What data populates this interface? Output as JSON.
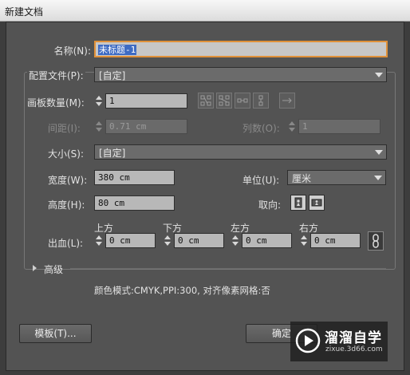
{
  "window": {
    "title": "新建文档"
  },
  "form": {
    "name_label": "名称(N):",
    "name_value": "未标题-1",
    "profile_label": "配置文件(P):",
    "profile_value": "[自定]",
    "artboards_label": "画板数量(M):",
    "artboards_value": "1",
    "spacing_label": "间距(I):",
    "spacing_value": "0.71 cm",
    "columns_label": "列数(O):",
    "columns_value": "1",
    "size_label": "大小(S):",
    "size_value": "[自定]",
    "width_label": "宽度(W):",
    "width_value": "380 cm",
    "units_label": "单位(U):",
    "units_value": "厘米",
    "height_label": "高度(H):",
    "height_value": "80 cm",
    "orientation_label": "取向:",
    "bleed_label": "出血(L):",
    "bleed": {
      "top_label": "上方",
      "top_value": "0 cm",
      "bottom_label": "下方",
      "bottom_value": "0 cm",
      "left_label": "左方",
      "left_value": "0 cm",
      "right_label": "右方",
      "right_value": "0 cm"
    },
    "advanced_label": "高级",
    "summary": "颜色模式:CMYK,PPI:300, 对齐像素网格:否"
  },
  "buttons": {
    "templates": "模板(T)...",
    "ok": "确定"
  },
  "icons": {
    "artboard_layout": [
      "grid-by-row-icon",
      "grid-by-column-icon",
      "arrange-by-row-icon",
      "arrange-by-column-icon",
      "right-to-left-icon"
    ],
    "orientation": [
      "portrait-icon",
      "landscape-icon"
    ],
    "link": "chain-link-icon",
    "advanced": "disclosure-triangle-icon"
  },
  "watermark": {
    "brand": "溜溜自学",
    "url": "zixue.3d66.com"
  },
  "colors": {
    "dialog_bg": "#535353",
    "focus_ring": "#e0913a",
    "selection": "#3e6bc3"
  }
}
